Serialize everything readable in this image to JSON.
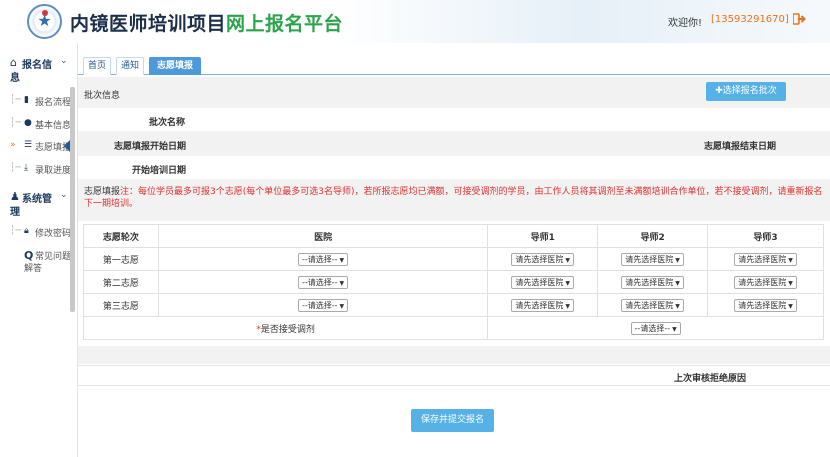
{
  "header": {
    "title_part1": "内镜医师培训项目",
    "title_part2": "网上报名平台",
    "welcome": "欢迎你!",
    "phone": "[13593291670]",
    "colors": {
      "accent": "#2aa44a",
      "phone": "#e8731c",
      "primary": "#4c9ad9"
    }
  },
  "sidebar": {
    "section1": {
      "label": "报名信",
      "label2": "息",
      "icon": "home-icon"
    },
    "items1": [
      {
        "label": "报名流程",
        "icon": "bookmark-icon"
      },
      {
        "label": "基本信息",
        "icon": "user-icon"
      },
      {
        "label": "志愿填报",
        "icon": "list-icon"
      },
      {
        "label": "录取进度",
        "icon": "download-icon"
      }
    ],
    "section2": {
      "label": "系统管",
      "label2": "理",
      "icon": "users-icon"
    },
    "items2": [
      {
        "label": "修改密码",
        "icon": "lock-icon"
      },
      {
        "label": "常见问题",
        "label2": "解答",
        "icon": "search-icon"
      }
    ]
  },
  "tabs": [
    {
      "label": "首页"
    },
    {
      "label": "通知"
    },
    {
      "label": "志愿填报",
      "active": true
    }
  ],
  "batch": {
    "section_label": "批次信息",
    "select_button": "✚选择报名批次",
    "name_label": "批次名称",
    "start_label": "志愿填报开始日期",
    "end_label": "志愿填报结束日期",
    "training_label": "开始培训日期"
  },
  "notice": {
    "prefix": "志愿填报",
    "text": "注：每位学员最多可报3个志愿(每个单位最多可选3名导师)，若所报志愿均已满额，可接受调剂的学员，由工作人员将其调剂至未满额培训合作单位，若不接受调剂，请重新报名下一期培训。"
  },
  "table": {
    "headers": [
      "志愿轮次",
      "医院",
      "导师1",
      "导师2",
      "导师3"
    ],
    "rows": [
      {
        "round": "第一志愿",
        "hospital": "--请选择--",
        "t1": "请先选择医院",
        "t2": "请先选择医院",
        "t3": "请先选择医院"
      },
      {
        "round": "第二志愿",
        "hospital": "--请选择--",
        "t1": "请先选择医院",
        "t2": "请先选择医院",
        "t3": "请先选择医院"
      },
      {
        "round": "第三志愿",
        "hospital": "--请选择--",
        "t1": "请先选择医院",
        "t2": "请先选择医院",
        "t3": "请先选择医院"
      }
    ],
    "accept_star": "*",
    "accept_label": "是否接受调剂",
    "accept_value": "--请选择--"
  },
  "reason_label": "上次审核拒绝原因",
  "submit_button": "保存并提交报名"
}
